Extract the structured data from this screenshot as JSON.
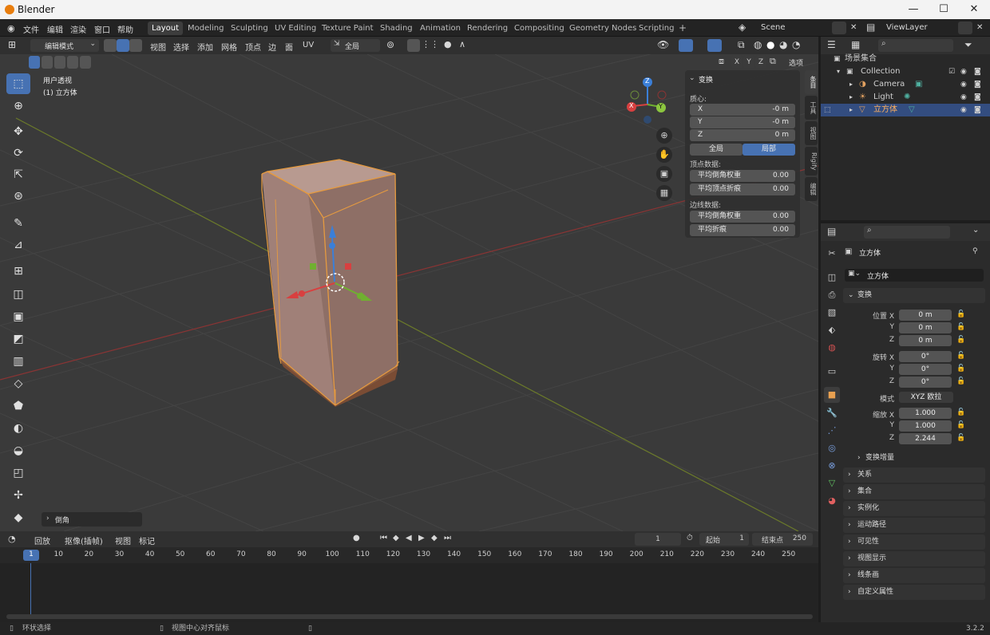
{
  "window": {
    "title": "Blender",
    "minimize": "—",
    "maximize": "☐",
    "close": "✕"
  },
  "menu": [
    "文件",
    "编辑",
    "渲染",
    "窗口",
    "帮助"
  ],
  "workspaces": [
    "Layout",
    "Modeling",
    "Sculpting",
    "UV Editing",
    "Texture Paint",
    "Shading",
    "Animation",
    "Rendering",
    "Compositing",
    "Geometry Nodes",
    "Scripting",
    "+"
  ],
  "active_workspace": "Layout",
  "scene": "Scene",
  "view_layer": "ViewLayer",
  "header3d": {
    "mode": "编辑模式",
    "menus": [
      "视图",
      "选择",
      "添加",
      "网格",
      "顶点",
      "边",
      "面",
      "UV"
    ],
    "transform_orientation": "全局",
    "axis_x": "X",
    "axis_y": "Y",
    "axis_z": "Z",
    "options": "选项"
  },
  "viewport": {
    "view_name": "用户透视",
    "object_label": "(1) 立方体",
    "last_op": "倒角",
    "gizmo": {
      "x": "X",
      "y": "Y",
      "z": "Z"
    }
  },
  "npanel": {
    "title": "变换",
    "median": "质心:",
    "x_label": "X",
    "x_val": "-0 m",
    "y_label": "Y",
    "y_val": "-0 m",
    "z_label": "Z",
    "z_val": "0 m",
    "global_btn": "全局",
    "local_btn": "局部",
    "vertex_data": "顶点数据:",
    "v_bevel_label": "平均倒角权重",
    "v_bevel_val": "0.00",
    "v_crease_label": "平均顶点折痕",
    "v_crease_val": "0.00",
    "edge_data": "边线数据:",
    "e_bevel_label": "平均倒角权重",
    "e_bevel_val": "0.00",
    "e_crease_label": "平均折痕",
    "e_crease_val": "0.00",
    "tabs": [
      "条目",
      "工具",
      "视图",
      "Rigify",
      "编辑"
    ]
  },
  "outliner": {
    "root": "场景集合",
    "collection": "Collection",
    "items": [
      "Camera",
      "Light",
      "立方体"
    ]
  },
  "props": {
    "object_name": "立方体",
    "data_name": "立方体",
    "transform": "变换",
    "location": "位置 X",
    "loc_x": "0 m",
    "loc_y": "0 m",
    "loc_z": "0 m",
    "rotation": "旋转 X",
    "rot_x": "0°",
    "rot_y": "0°",
    "rot_z": "0°",
    "mode_label": "模式",
    "mode_val": "XYZ 欧拉",
    "scale": "缩放 X",
    "sc_x": "1.000",
    "sc_y": "1.000",
    "sc_z": "2.244",
    "y": "Y",
    "z": "Z",
    "delta": "变换增量",
    "sections": [
      "关系",
      "集合",
      "实例化",
      "运动路径",
      "可见性",
      "视图显示",
      "线条画",
      "自定义属性"
    ]
  },
  "timeline": {
    "menus": [
      "回放",
      "抠像(插帧)",
      "视图",
      "标记"
    ],
    "current": "1",
    "start_label": "起始",
    "start": "1",
    "end_label": "结束点",
    "end": "250",
    "ticks": [
      "1",
      "10",
      "20",
      "30",
      "40",
      "50",
      "60",
      "70",
      "80",
      "90",
      "100",
      "110",
      "120",
      "130",
      "140",
      "150",
      "160",
      "170",
      "180",
      "190",
      "200",
      "210",
      "220",
      "230",
      "240",
      "250"
    ]
  },
  "status": {
    "left": "环状选择",
    "mid": "视图中心对齐鼠标",
    "version": "3.2.2"
  }
}
